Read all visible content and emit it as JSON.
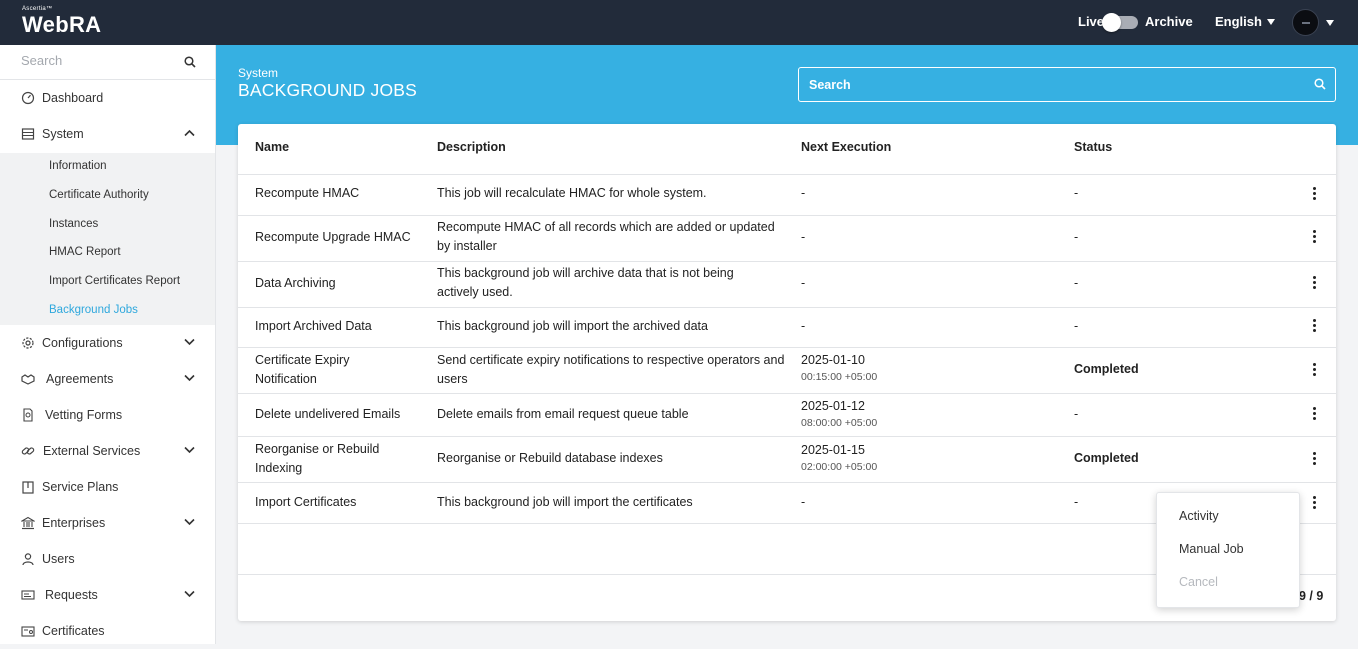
{
  "app": {
    "brand_super": "Ascertia™",
    "brand_name": "WebRA"
  },
  "topbar": {
    "live_label": "Live",
    "archive_label": "Archive",
    "language": "English"
  },
  "sidebar": {
    "search_placeholder": "Search",
    "items": [
      {
        "label": "Dashboard",
        "icon": "dashboard-icon"
      },
      {
        "label": "System",
        "icon": "server-icon",
        "expanded": true
      },
      {
        "label": "Configurations",
        "icon": "gear-icon"
      },
      {
        "label": "Agreements",
        "icon": "handshake-icon"
      },
      {
        "label": "Vetting Forms",
        "icon": "document-search-icon"
      },
      {
        "label": "External Services",
        "icon": "link-icon"
      },
      {
        "label": "Service Plans",
        "icon": "box-icon"
      },
      {
        "label": "Enterprises",
        "icon": "bank-icon"
      },
      {
        "label": "Users",
        "icon": "user-icon"
      },
      {
        "label": "Requests",
        "icon": "request-icon"
      },
      {
        "label": "Certificates",
        "icon": "certificate-icon"
      }
    ],
    "system_sub": [
      "Information",
      "Certificate Authority",
      "Instances",
      "HMAC Report",
      "Import Certificates Report",
      "Background Jobs"
    ]
  },
  "header": {
    "breadcrumb": "System",
    "title": "BACKGROUND JOBS",
    "search_placeholder": "Search"
  },
  "table": {
    "columns": [
      "Name",
      "Description",
      "Next Execution",
      "Status"
    ],
    "rows": [
      {
        "name": "Recompute HMAC",
        "description": "This job will recalculate HMAC for whole system.",
        "next_date": "-",
        "next_time": "",
        "status": "-"
      },
      {
        "name": "Recompute Upgrade HMAC",
        "description": "Recompute HMAC of all records which are added or updated by installer",
        "next_date": "-",
        "next_time": "",
        "status": "-"
      },
      {
        "name": "Data Archiving",
        "description": "This background job will archive data that is not being actively used.",
        "next_date": "-",
        "next_time": "",
        "status": "-"
      },
      {
        "name": "Import Archived Data",
        "description": "This background job will import the archived data",
        "next_date": "-",
        "next_time": "",
        "status": "-"
      },
      {
        "name": "Certificate Expiry Notification",
        "description": "Send certificate expiry notifications to respective operators and users",
        "next_date": "2025-01-10",
        "next_time": "00:15:00 +05:00",
        "status": "Completed"
      },
      {
        "name": "Delete undelivered Emails",
        "description": "Delete emails from email request queue table",
        "next_date": "2025-01-12",
        "next_time": "08:00:00 +05:00",
        "status": "-"
      },
      {
        "name": "Reorganise or Rebuild Indexing",
        "description": "Reorganise or Rebuild database indexes",
        "next_date": "2025-01-15",
        "next_time": "02:00:00 +05:00",
        "status": "Completed"
      },
      {
        "name": "Import Certificates",
        "description": "This background job will import the certificates",
        "next_date": "-",
        "next_time": "",
        "status": "-"
      }
    ],
    "pager": "9 / 9"
  },
  "context_menu": {
    "items": [
      "Activity",
      "Manual Job",
      "Cancel"
    ],
    "disabled": [
      "Cancel"
    ]
  },
  "colors": {
    "topbar": "#222b3a",
    "accent": "#36b0e2",
    "active_link": "#2fa8dd"
  }
}
